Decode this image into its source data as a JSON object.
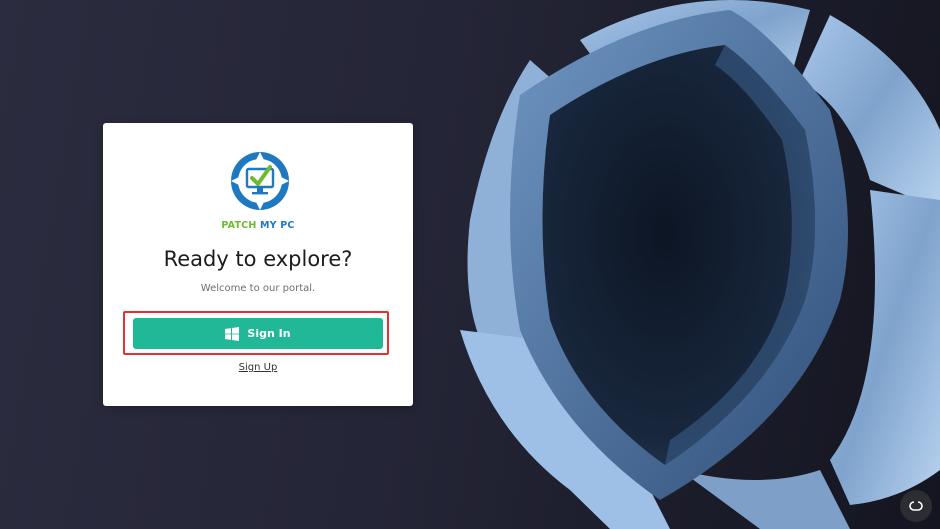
{
  "brand": {
    "logo_word_1": "PATCH",
    "logo_word_2": "MY PC",
    "logo_icon": "monitor-check-icon",
    "green": "#6cbb2f",
    "blue": "#1f79c1"
  },
  "card": {
    "heading": "Ready to explore?",
    "subtitle": "Welcome to our portal.",
    "signin_label": "Sign In",
    "signin_icon": "windows-icon",
    "signin_color": "#20b896",
    "signup_label": "Sign Up",
    "highlight_color": "#e5302f"
  },
  "hero": {
    "icon": "shield-icon"
  },
  "chat_widget": {
    "icon": "chat-icon"
  }
}
